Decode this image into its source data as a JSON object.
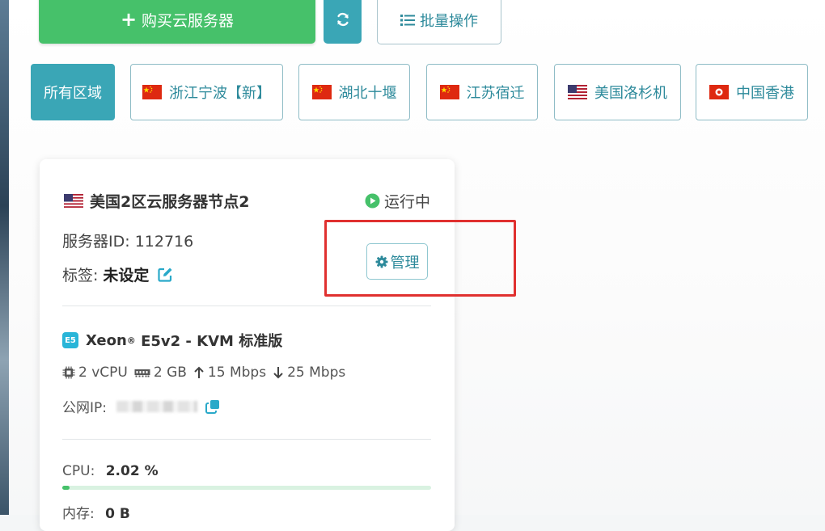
{
  "toolbar": {
    "buy_label": "购买云服务器",
    "batch_label": "批量操作",
    "accent_green": "#46c16a",
    "accent_teal": "#3aa6b6"
  },
  "regions": [
    {
      "label": "所有区域",
      "active": true
    },
    {
      "label": "浙江宁波【新】",
      "flag": "china-flag"
    },
    {
      "label": "湖北十堰",
      "flag": "china-flag"
    },
    {
      "label": "江苏宿迁",
      "flag": "china-flag"
    },
    {
      "label": "美国洛杉机",
      "flag": "usa-flag"
    },
    {
      "label": "中国香港",
      "flag": "hong-kong-flag"
    }
  ],
  "server": {
    "name": "美国2区云服务器节点2",
    "status": "运行中",
    "id_label": "服务器ID:",
    "id_value": "112716",
    "tag_label": "标签:",
    "tag_value": "未设定",
    "manage_label": "管理",
    "cpu_badge": "E5",
    "spec_main": "Xeon",
    "spec_reg": "®",
    "spec_rest": " E5v2 - KVM 标准版",
    "vcpu": "2 vCPU",
    "memory": "2 GB",
    "upload": "15 Mbps",
    "download": "25 Mbps",
    "ip_label": "公网IP:",
    "cpu_label": "CPU:",
    "cpu_value": "2.02 %",
    "cpu_fraction": 0.0202,
    "mem_label": "内存:",
    "mem_value": "0 B"
  }
}
